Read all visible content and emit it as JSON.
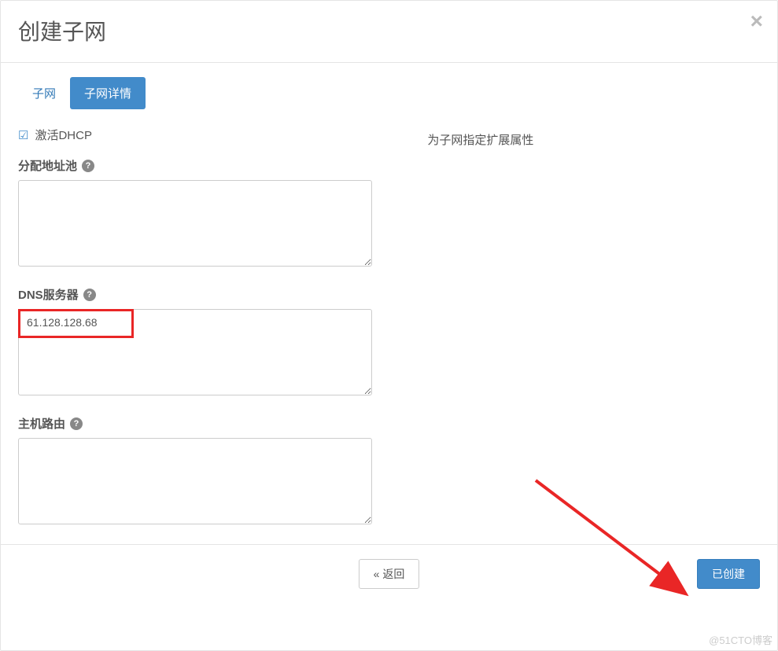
{
  "modal": {
    "title": "创建子网",
    "close_glyph": "×"
  },
  "tabs": {
    "subnet": "子网",
    "details": "子网详情"
  },
  "form": {
    "dhcp_checkbox_label": "激活DHCP",
    "pool_label": "分配地址池",
    "pool_value": "",
    "dns_label": "DNS服务器",
    "dns_value": "61.128.128.68",
    "routes_label": "主机路由",
    "routes_value": ""
  },
  "right": {
    "desc": "为子网指定扩展属性"
  },
  "footer": {
    "back": "« 返回",
    "create": "已创建"
  },
  "watermark": "@51CTO博客"
}
